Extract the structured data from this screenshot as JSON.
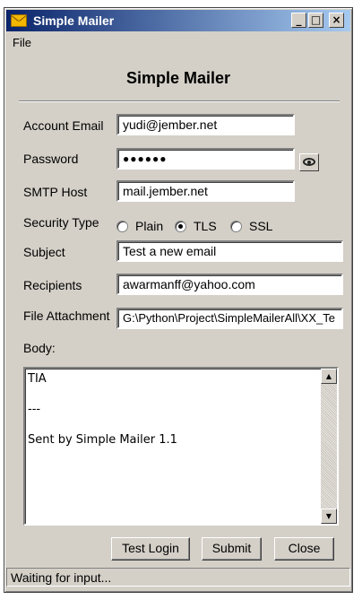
{
  "window": {
    "title": "Simple Mailer",
    "icon": "envelope-icon",
    "controls": {
      "minimize": "_",
      "maximize": "□",
      "close": "×"
    }
  },
  "menu": {
    "file": "File"
  },
  "heading": "Simple Mailer",
  "form": {
    "account_email": {
      "label": "Account Email",
      "value": "yudi@jember.net"
    },
    "password": {
      "label": "Password",
      "value": "●●●●●●",
      "toggle_icon": "eye-icon"
    },
    "smtp_host": {
      "label": "SMTP Host",
      "value": "mail.jember.net"
    },
    "security_type": {
      "label": "Security Type",
      "options": [
        "Plain",
        "TLS",
        "SSL"
      ],
      "selected": "TLS"
    },
    "subject": {
      "label": "Subject",
      "value": "Test a new email"
    },
    "recipients": {
      "label": "Recipients",
      "value": "awarmanff@yahoo.com"
    },
    "file_attachment": {
      "label": "File Attachment",
      "value": "G:\\Python\\Project\\SimpleMailerAll\\XX_Te"
    },
    "body": {
      "label": "Body:",
      "value": "TIA\n\n---\n\nSent by Simple Mailer 1.1"
    }
  },
  "buttons": {
    "test_login": "Test Login",
    "submit": "Submit",
    "close": "Close"
  },
  "status": "Waiting for input..."
}
